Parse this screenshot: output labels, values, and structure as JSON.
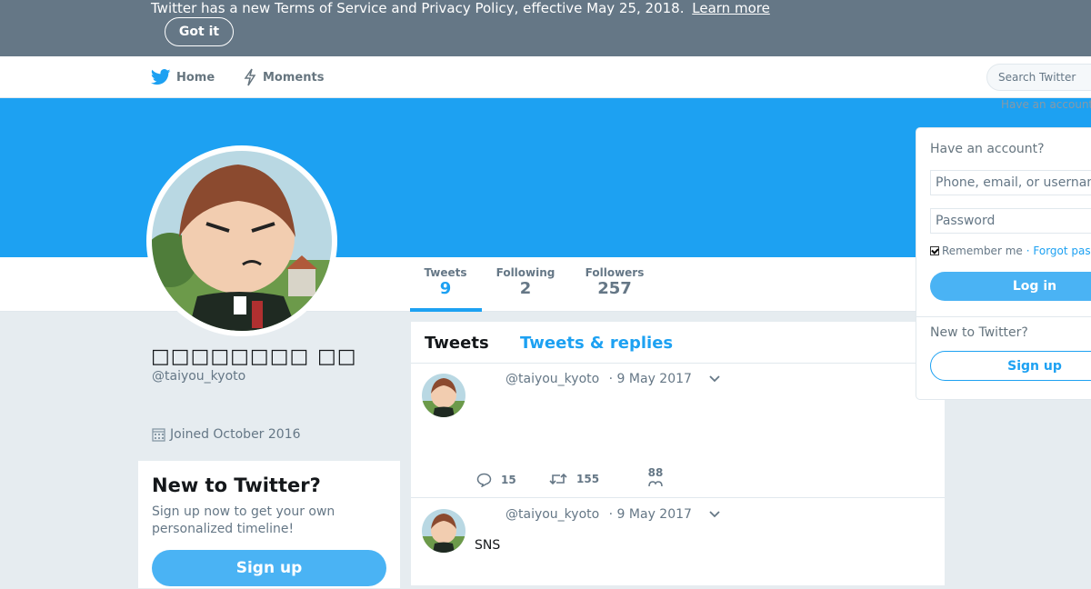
{
  "banner": {
    "text": "Twitter has a new Terms of Service and Privacy Policy, effective May 25, 2018.",
    "link": "Learn more",
    "button": "Got it"
  },
  "nav": {
    "home": "Home",
    "moments": "Moments",
    "search_placeholder": "Search Twitter",
    "have_account": "Have an account?"
  },
  "colors": {
    "brand": "#1da1f2",
    "banner": "#657786",
    "background": "#e6ecf0"
  },
  "profile": {
    "name": "□□□□□□□□ □□",
    "handle": "@taiyou_kyoto",
    "joined": "Joined October 2016",
    "stats": [
      {
        "label": "Tweets",
        "value": "9"
      },
      {
        "label": "Following",
        "value": "2"
      },
      {
        "label": "Followers",
        "value": "257"
      }
    ]
  },
  "new_card": {
    "title": "New to Twitter?",
    "text": "Sign up now to get your own personalized timeline!",
    "button": "Sign up"
  },
  "timeline": {
    "tabs": [
      "Tweets",
      "Tweets & replies"
    ],
    "tweets": [
      {
        "handle": "@taiyou_kyoto",
        "date": "· 9 May 2017",
        "text": "",
        "replies": "15",
        "retweets": "155",
        "likes": "88"
      },
      {
        "handle": "@taiyou_kyoto",
        "date": "· 9 May 2017",
        "text": "SNS"
      }
    ]
  },
  "login": {
    "title": "Have an account?",
    "user_placeholder": "Phone, email, or username",
    "password_placeholder": "Password",
    "remember": "Remember me",
    "forgot": "· Forgot password?",
    "login_button": "Log in",
    "new_to_twitter": "New to Twitter?",
    "signup_button": "Sign up"
  },
  "icons": [
    "twitter-bird-icon",
    "moments-bolt-icon",
    "calendar-icon",
    "reply-icon",
    "retweet-icon",
    "like-icon",
    "caret-down-icon"
  ]
}
